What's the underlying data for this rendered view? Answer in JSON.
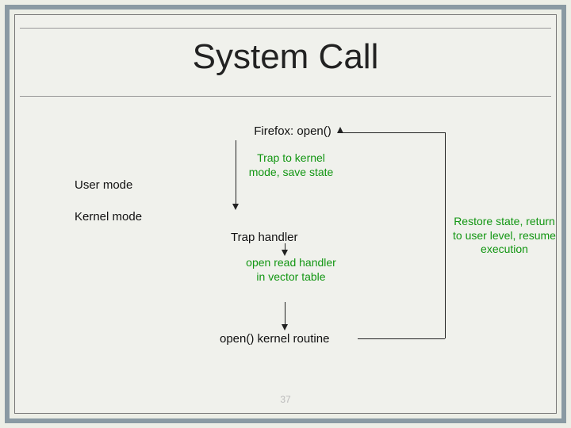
{
  "title": "System Call",
  "labels": {
    "user_mode": "User mode",
    "kernel_mode": "Kernel mode"
  },
  "flow": {
    "firefox": "Firefox: open()",
    "trap_to": "Trap to kernel mode, save state",
    "trap_handler": "Trap handler",
    "open_read": "open read handler in vector table",
    "open_routine": "open() kernel routine"
  },
  "restore": "Restore state, return to user level, resume execution",
  "slide_number": "37",
  "colors": {
    "border": "#8a9aa3",
    "annotation": "#129612",
    "background": "#eceee6"
  }
}
